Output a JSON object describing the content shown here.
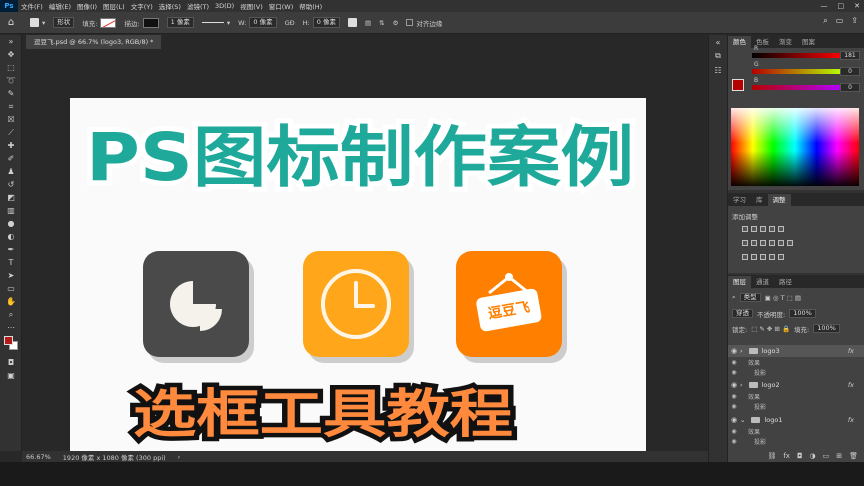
{
  "menu": {
    "logo": "Ps",
    "items": [
      "文件(F)",
      "编辑(E)",
      "图像(I)",
      "图层(L)",
      "文字(Y)",
      "选择(S)",
      "滤镜(T)",
      "3D(D)",
      "视图(V)",
      "窗口(W)",
      "帮助(H)"
    ],
    "minimize": "—",
    "maximize": "□",
    "close": "✕"
  },
  "options": {
    "mode": "形状",
    "fill_label": "填充:",
    "stroke_label": "描边:",
    "stroke_width": "1 像素",
    "w_label": "W:",
    "w_value": "0 像素",
    "link": "GĐ",
    "h_label": "H:",
    "h_value": "0 像素",
    "align_edges": "对齐边缘"
  },
  "document": {
    "tab_title": "逗豆飞.psd @ 66.7% (logo3, RGB/8) *",
    "title_main": "PS图标制作案例",
    "title_sub": "选框工具教程",
    "sign_text": "逗豆飞"
  },
  "status": {
    "zoom": "66.67%",
    "doc_info": "1920 像素 x 1080 像素 (300 ppi)"
  },
  "color_panel": {
    "tabs": [
      "颜色",
      "色板",
      "渐变",
      "图案"
    ],
    "r_label": "R",
    "g_label": "G",
    "b_label": "B",
    "r_value": "181",
    "g_value": "0",
    "b_value": "0",
    "fg_color": "#b50000"
  },
  "adjust_panel": {
    "tabs": [
      "学习",
      "库",
      "调整"
    ],
    "add_label": "添加调整"
  },
  "layers_panel": {
    "tabs": [
      "图层",
      "通道",
      "路径"
    ],
    "filter_kind": "类型",
    "blend_mode": "穿透",
    "opacity_label": "不透明度:",
    "opacity_value": "100%",
    "lock_label": "锁定:",
    "fill_label": "填充:",
    "fill_value": "100%",
    "layers": [
      {
        "name": "logo3",
        "effects": "效果",
        "effect_item": "投影"
      },
      {
        "name": "logo2",
        "effects": "效果",
        "effect_item": "投影"
      },
      {
        "name": "logo1",
        "effects": "效果",
        "effect_item": "投影"
      }
    ],
    "fx": "fx"
  },
  "colors": {
    "title_teal": "#1fa99a",
    "title_orange": "#ff8a3d",
    "tile_gray": "#4a4a4a",
    "tile_yellow": "#ffa61a",
    "tile_orange": "#ff7f00"
  }
}
